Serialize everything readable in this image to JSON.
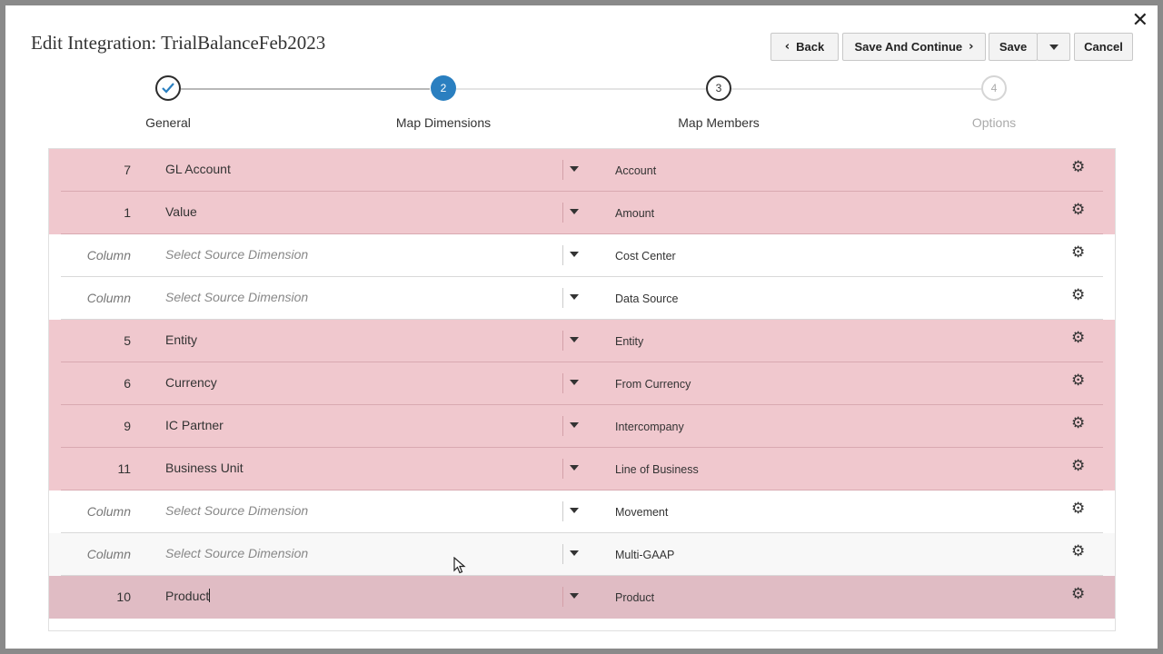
{
  "dialog": {
    "title": "Edit Integration: TrialBalanceFeb2023",
    "close_icon": "close-icon"
  },
  "toolbar": {
    "back_label": "Back",
    "save_continue_label": "Save And Continue",
    "save_label": "Save",
    "cancel_label": "Cancel"
  },
  "train": {
    "steps": [
      {
        "label": "General",
        "number": "",
        "state": "completed"
      },
      {
        "label": "Map Dimensions",
        "number": "2",
        "state": "current"
      },
      {
        "label": "Map Members",
        "number": "3",
        "state": "enabled"
      },
      {
        "label": "Options",
        "number": "4",
        "state": "disabled"
      }
    ]
  },
  "mappings": {
    "rows": [
      {
        "column": "7",
        "source": "GL Account",
        "target": "Account",
        "mapped": true
      },
      {
        "column": "1",
        "source": "Value",
        "target": "Amount",
        "mapped": true
      },
      {
        "column": "Column",
        "source": "Select Source Dimension",
        "target": "Cost Center",
        "mapped": false
      },
      {
        "column": "Column",
        "source": "Select Source Dimension",
        "target": "Data Source",
        "mapped": false
      },
      {
        "column": "5",
        "source": "Entity",
        "target": "Entity",
        "mapped": true
      },
      {
        "column": "6",
        "source": "Currency",
        "target": "From Currency",
        "mapped": true
      },
      {
        "column": "9",
        "source": "IC Partner",
        "target": "Intercompany",
        "mapped": true
      },
      {
        "column": "11",
        "source": "Business Unit",
        "target": "Line of Business",
        "mapped": true
      },
      {
        "column": "Column",
        "source": "Select Source Dimension",
        "target": "Movement",
        "mapped": false
      },
      {
        "column": "Column",
        "source": "Select Source Dimension",
        "target": "Multi-GAAP",
        "mapped": false
      },
      {
        "column": "10",
        "source": "Product",
        "target": "Product",
        "mapped": true,
        "active": true
      }
    ]
  },
  "colors": {
    "accent": "#2a7fc0",
    "mapped_row": "#f0c8ce",
    "active_row": "#e0bcc4"
  }
}
